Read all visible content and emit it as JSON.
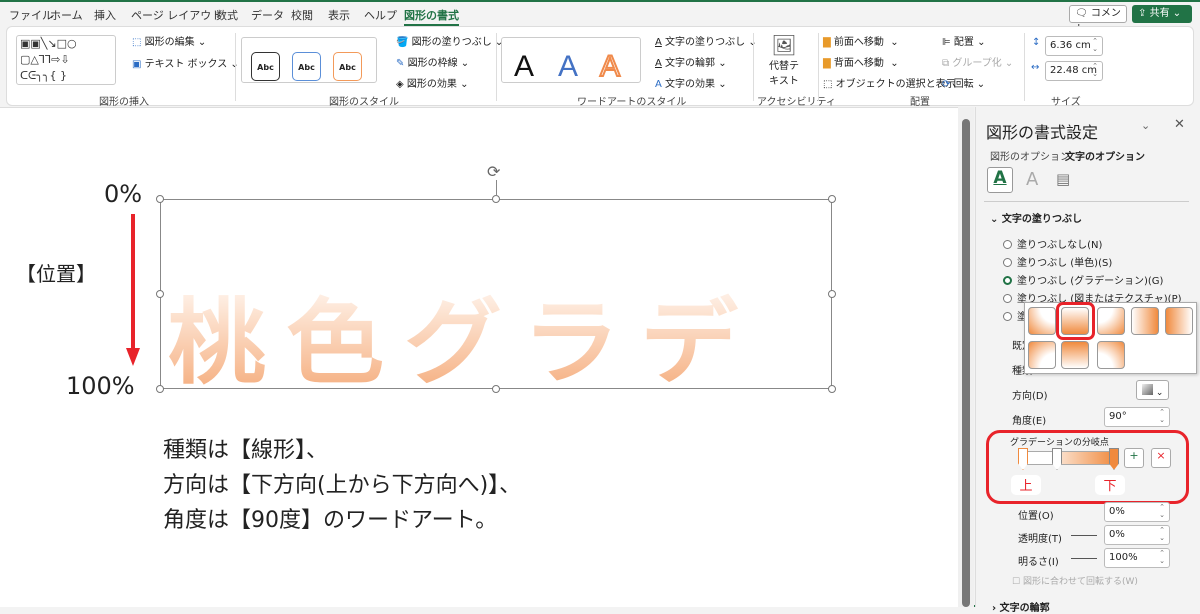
{
  "tabs": [
    "ファイル",
    "ホーム",
    "挿入",
    "ページ レイアウト",
    "数式",
    "データ",
    "校閲",
    "表示",
    "ヘルプ",
    "図形の書式"
  ],
  "top_buttons": {
    "comment": "コメント",
    "share": "共有"
  },
  "ribbon": {
    "insert_shapes": {
      "label": "図形の挿入",
      "edit_shape": "図形の編集",
      "text_box": "テキスト ボックス"
    },
    "shape_styles": {
      "label": "図形のスタイル",
      "sample": "Abc",
      "fill": "図形の塗りつぶし",
      "outline": "図形の枠線",
      "effects": "図形の効果"
    },
    "wordart_styles": {
      "label": "ワードアートのスタイル",
      "sample": "A",
      "text_fill": "文字の塗りつぶし",
      "text_outline": "文字の輪郭",
      "text_effects": "文字の効果"
    },
    "accessibility": {
      "label": "アクセシビリティ",
      "alt_text_1": "代替テ",
      "alt_text_2": "キスト"
    },
    "arrange": {
      "label": "配置",
      "bring_forward": "前面へ移動",
      "send_backward": "背面へ移動",
      "selection_pane": "オブジェクトの選択と表示",
      "align": "配置",
      "group": "グループ化",
      "rotate": "回転"
    },
    "size": {
      "label": "サイズ",
      "height": "6.36 cm",
      "width": "22.48 cm"
    }
  },
  "canvas": {
    "wordart_text": "桃色グラデ",
    "label_top": "0%",
    "label_bottom": "100%",
    "label_position": "【位置】",
    "caption": [
      "種類は【線形】、",
      "方向は【下方向(上から下方向へ)】、",
      "角度は【90度】のワードアート。"
    ],
    "gradient_colors": {
      "top": "#ffffff",
      "bottom": "#f4a774"
    },
    "arrow_color": "#e8232a"
  },
  "panel": {
    "title": "図形の書式設定",
    "tab_shape": "図形のオプション",
    "tab_text": "文字のオプション",
    "section": "文字の塗りつぶし",
    "fill_options": [
      "塗りつぶしなし(N)",
      "塗りつぶし (単色)(S)",
      "塗りつぶし (グラデーション)(G)",
      "塗りつぶし (図またはテクスチャ)(P)",
      "塗"
    ],
    "selected_fill": 2,
    "preset_label": "既定",
    "type_label": "種類",
    "direction_label": "方向(D)",
    "angle_label": "角度(E)",
    "angle_value": "90°",
    "stops_label": "グラデーションの分岐点",
    "stop_top": "上",
    "stop_bottom": "下",
    "position_label": "位置(O)",
    "position_value": "0%",
    "transparency_label": "透明度(T)",
    "transparency_value": "0%",
    "brightness_label": "明るさ(I)",
    "brightness_value": "100%",
    "rotate_with_shape": "図形に合わせて回転する(W)",
    "next_section": "文字の輪郭"
  }
}
